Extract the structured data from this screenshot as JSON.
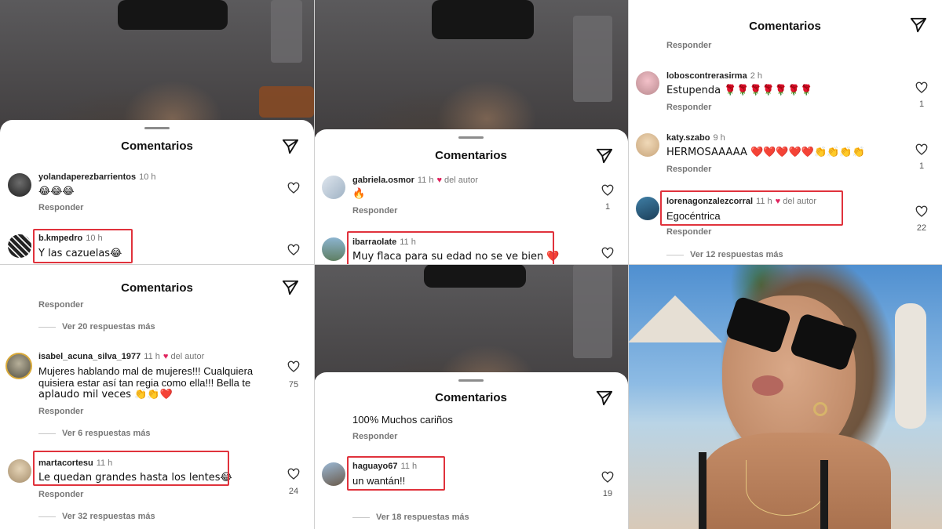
{
  "sheet_title": "Comentarios",
  "reply_label": "Responder",
  "author_label": "del autor",
  "colors": {
    "highlight": "#e0323c",
    "heart": "#e0245e"
  },
  "panel1": {
    "comments": [
      {
        "user": "yolandaperezbarrientos",
        "time": "10 h",
        "text": "😂😂😂",
        "reply": "Responder"
      },
      {
        "user": "b.kmpedro",
        "time": "10 h",
        "text": "Y las cazuelas😂"
      }
    ]
  },
  "panel2": {
    "comments": [
      {
        "user": "gabriela.osmor",
        "time": "11 h",
        "author": "del autor",
        "text": "🔥",
        "reply": "Responder",
        "likes": "1"
      },
      {
        "user": "ibarraolate",
        "time": "11 h",
        "text": "Muy flaca para su edad  no se ve bien ❤️"
      }
    ]
  },
  "panel3": {
    "top_reply": "Responder",
    "comments": [
      {
        "user": "loboscontrerasirma",
        "time": "2 h",
        "text": "Estupenda 🌹🌹🌹🌹🌹🌹🌹",
        "reply": "Responder",
        "likes": "1"
      },
      {
        "user": "katy.szabo",
        "time": "9 h",
        "text": "HERMOSAAAAA ❤️❤️❤️❤️❤️👏👏👏👏",
        "reply": "Responder",
        "likes": "1"
      },
      {
        "user": "lorenagonzalezcorral",
        "time": "11 h",
        "author": "del autor",
        "text": "Egocéntrica",
        "reply": "Responder",
        "likes": "22"
      }
    ],
    "more": "Ver 12 respuestas más"
  },
  "panel4": {
    "top_reply": "Responder",
    "more_top": "Ver 20 respuestas más",
    "comments": [
      {
        "user": "isabel_acuna_silva_1977",
        "time": "11 h",
        "author": "del autor",
        "lines": [
          "Mujeres hablando mal de mujeres!!! Cualquiera",
          "quisiera estar así tan regia como ella!!! Bella te",
          "aplaudo mil veces 👏👏❤️"
        ],
        "reply": "Responder",
        "likes": "75",
        "more": "Ver 6 respuestas más"
      },
      {
        "user": "martacortesu",
        "time": "11 h",
        "text": "Le quedan grandes hasta los lentes😂",
        "reply": "Responder",
        "likes": "24",
        "more": "Ver 32 respuestas más"
      }
    ]
  },
  "panel5": {
    "top_text": "100% Muchos cariños",
    "top_reply": "Responder",
    "comments": [
      {
        "user": "haguayo67",
        "time": "11 h",
        "text": "un wantán!!",
        "likes": "19",
        "more": "Ver 18 respuestas más"
      }
    ]
  }
}
